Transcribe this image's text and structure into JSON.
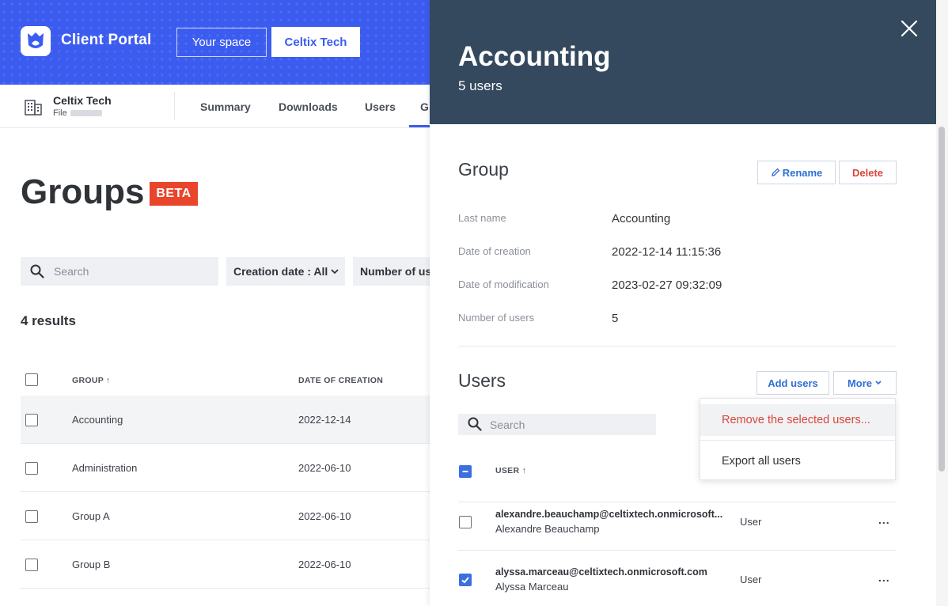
{
  "app": {
    "title": "Client Portal",
    "your_space_label": "Your space",
    "org_button_label": "Celtix Tech"
  },
  "org": {
    "name": "Celtix Tech",
    "file_label": "File"
  },
  "nav": {
    "tabs": [
      {
        "label": "Summary"
      },
      {
        "label": "Downloads"
      },
      {
        "label": "Users"
      },
      {
        "label": "G"
      }
    ]
  },
  "groups_page": {
    "title": "Groups",
    "badge": "BETA",
    "search_placeholder": "Search",
    "filters": [
      {
        "label": "Creation date : All"
      },
      {
        "label": "Number of us"
      }
    ],
    "results_count": "4 results",
    "columns": [
      "GROUP",
      "DATE OF CREATION"
    ],
    "rows": [
      {
        "name": "Accounting",
        "date": "2022-12-14"
      },
      {
        "name": "Administration",
        "date": "2022-06-10"
      },
      {
        "name": "Group A",
        "date": "2022-06-10"
      },
      {
        "name": "Group B",
        "date": "2022-06-10"
      }
    ]
  },
  "panel": {
    "title": "Accounting",
    "subtitle": "5 users",
    "group_section": {
      "title": "Group",
      "rename_label": "Rename",
      "delete_label": "Delete",
      "fields": [
        {
          "label": "Last name",
          "value": "Accounting"
        },
        {
          "label": "Date of creation",
          "value": "2022-12-14 11:15:36"
        },
        {
          "label": "Date of modification",
          "value": "2023-02-27 09:32:09"
        },
        {
          "label": "Number of users",
          "value": "5"
        }
      ]
    },
    "users_section": {
      "title": "Users",
      "add_users_label": "Add users",
      "more_label": "More",
      "search_placeholder": "Search",
      "column_user": "USER",
      "menu": {
        "remove_label": "Remove the selected users...",
        "export_label": "Export all users"
      },
      "users": [
        {
          "email": "alexandre.beauchamp@celtixtech.onmicrosoft...",
          "name": "Alexandre Beauchamp",
          "role": "User",
          "more": "...",
          "checked": false
        },
        {
          "email": "alyssa.marceau@celtixtech.onmicrosoft.com",
          "name": "Alyssa Marceau",
          "role": "User",
          "more": "...",
          "checked": true
        }
      ]
    }
  },
  "colors": {
    "brand_blue": "#3c5cf0",
    "panel_header": "#34495e",
    "beta_badge": "#e8452c",
    "danger": "#d9453b",
    "link_blue": "#2f6fd6"
  }
}
